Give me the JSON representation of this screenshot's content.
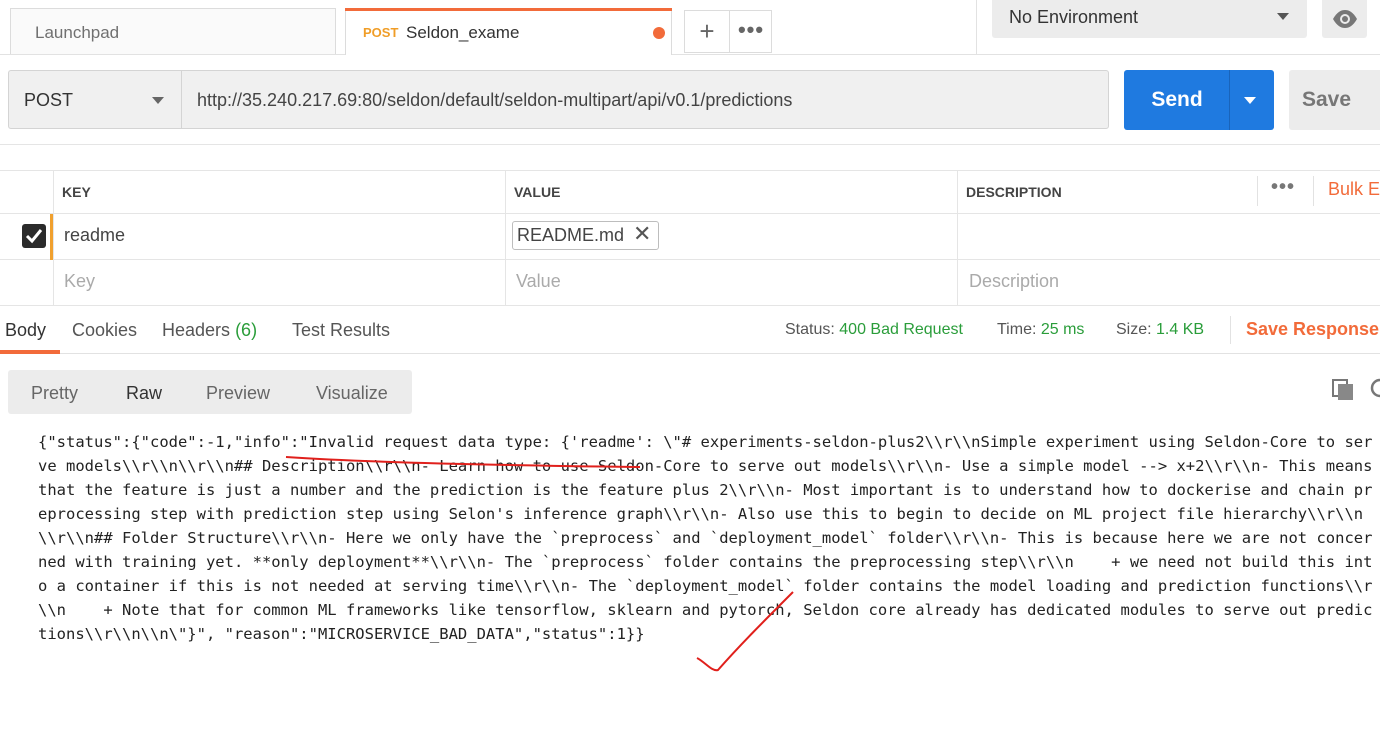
{
  "tabs": {
    "launchpad": "Launchpad",
    "active_method": "POST",
    "active_name": "Seldon_exame",
    "add": "+",
    "more": "•••"
  },
  "environment": {
    "selected": "No Environment"
  },
  "request": {
    "method": "POST",
    "url": "http://35.240.217.69:80/seldon/default/seldon-multipart/api/v0.1/predictions",
    "send_label": "Send",
    "save_label": "Save"
  },
  "params": {
    "headers": {
      "key": "KEY",
      "value": "VALUE",
      "description": "DESCRIPTION",
      "bulk_edit": "Bulk E",
      "more": "•••"
    },
    "rows": [
      {
        "checked": true,
        "key": "readme",
        "value_file": "README.md",
        "value_remove": "✕",
        "description": ""
      }
    ],
    "placeholder": {
      "key": "Key",
      "value": "Value",
      "description": "Description"
    }
  },
  "response": {
    "tabs": {
      "body": "Body",
      "cookies": "Cookies",
      "headers": "Headers",
      "headers_count": "(6)",
      "tests": "Test Results"
    },
    "status_label": "Status:",
    "status_value": "400 Bad Request",
    "time_label": "Time:",
    "time_value": "25 ms",
    "size_label": "Size:",
    "size_value": "1.4 KB",
    "save_response": "Save Response",
    "formats": [
      "Pretty",
      "Raw",
      "Preview",
      "Visualize"
    ],
    "active_format": "Raw",
    "body_text": "{\"status\":{\"code\":-1,\"info\":\"Invalid request data type: {'readme': \\\"# experiments-seldon-plus2\\\\r\\\\nSimple experiment using Seldon-Core to serve models\\\\r\\\\n\\\\r\\\\n## Description\\\\r\\\\n- Learn how to use Seldon-Core to serve out models\\\\r\\\\n- Use a simple model --> x+2\\\\r\\\\n- This means that the feature is just a number and the prediction is the feature plus 2\\\\r\\\\n- Most important is to understand how to dockerise and chain preprocessing step with prediction step using Selon's inference graph\\\\r\\\\n- Also use this to begin to decide on ML project file hierarchy\\\\r\\\\n\\\\r\\\\n## Folder Structure\\\\r\\\\n- Here we only have the `preprocess` and `deployment_model` folder\\\\r\\\\n- This is because here we are not concerned with training yet. **only deployment**\\\\r\\\\n- The `preprocess` folder contains the preprocessing step\\\\r\\\\n    + we need not build this into a container if this is not needed at serving time\\\\r\\\\n- The `deployment_model` folder contains the model loading and prediction functions\\\\r\\\\n    + Note that for common ML frameworks like tensorflow, sklearn and pytorch, Seldon core already has dedicated modules to serve out predictions\\\\r\\\\n\\\\n\\\"}\", \"reason\":\"MICROSERVICE_BAD_DATA\",\"status\":1}}"
  },
  "colors": {
    "accent": "#f26b3a",
    "send": "#1f7ae0",
    "success": "#2a9d3a",
    "method_post": "#f09d27",
    "annotation": "#e0201c"
  }
}
